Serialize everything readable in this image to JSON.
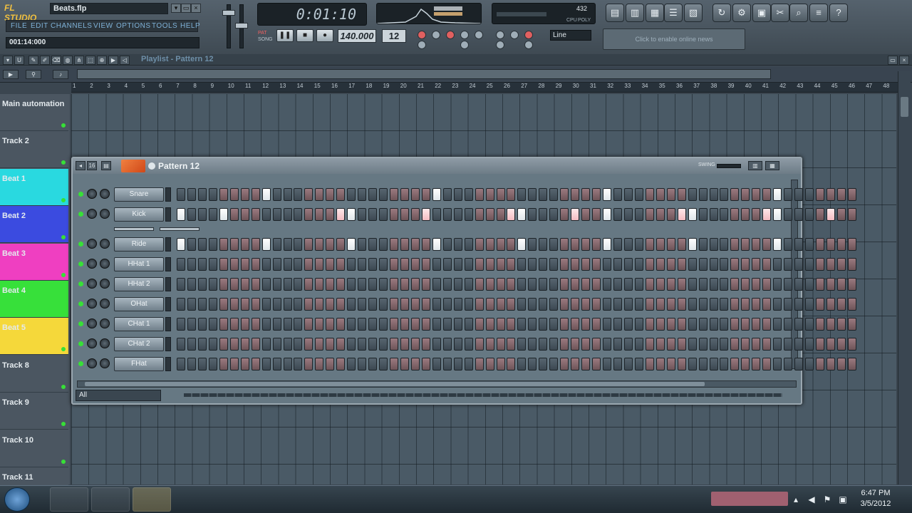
{
  "app": {
    "logo": "FL STUDIO",
    "filename": "Beats.flp"
  },
  "menu": [
    "FILE",
    "EDIT",
    "CHANNELS",
    "VIEW",
    "OPTIONS",
    "TOOLS",
    "HELP"
  ],
  "hint": "001:14:000",
  "transport": {
    "time": "0:01:10",
    "tempo": "140.000",
    "pattern_num": "12",
    "snap": "Line",
    "news": "Click to enable online news",
    "mode_label_pat": "PAT",
    "mode_label_song": "SONG"
  },
  "cpu": {
    "ram": "432",
    "label_cpu": "CPU",
    "label_poly": "POLY"
  },
  "playlist": {
    "title": "Playlist - Pattern 12",
    "ruler": [
      "1",
      "2",
      "3",
      "4",
      "5",
      "6",
      "7",
      "8",
      "9",
      "10",
      "11",
      "12",
      "13",
      "14",
      "15",
      "16",
      "17",
      "18",
      "19",
      "20",
      "21",
      "22",
      "23",
      "24",
      "25",
      "26",
      "27",
      "28",
      "29",
      "30",
      "31",
      "32",
      "33",
      "34",
      "35",
      "36",
      "37",
      "38",
      "39",
      "40",
      "41",
      "42",
      "43",
      "44",
      "45",
      "46",
      "47",
      "48"
    ],
    "tracks": [
      {
        "name": "Main automation",
        "color": "#4b5661"
      },
      {
        "name": "Track 2",
        "color": "#4b5661"
      },
      {
        "name": "Beat 1",
        "color": "#29d9e0"
      },
      {
        "name": "Beat 2",
        "color": "#3b4be0"
      },
      {
        "name": "Beat 3",
        "color": "#ef3fc1"
      },
      {
        "name": "Beat 4",
        "color": "#37e03a"
      },
      {
        "name": "Beat 5",
        "color": "#f5d83a"
      },
      {
        "name": "Track 8",
        "color": "#4b5661"
      },
      {
        "name": "Track 9",
        "color": "#4b5661"
      },
      {
        "name": "Track 10",
        "color": "#4b5661"
      },
      {
        "name": "Track 11",
        "color": "#4b5661"
      }
    ]
  },
  "sequencer": {
    "title": "Pattern 12",
    "swing_label": "SWING",
    "filter": "All",
    "channels": [
      {
        "name": "Snare",
        "on": [
          8,
          24,
          40,
          56
        ],
        "pink": []
      },
      {
        "name": "Kick",
        "on": [
          0,
          4,
          16,
          32,
          40,
          48,
          56,
          64
        ],
        "pink": [
          15,
          23,
          31,
          37,
          47,
          55,
          61
        ]
      },
      {
        "name": "Ride",
        "on": [
          0,
          8,
          16,
          24,
          32,
          40,
          48,
          56
        ],
        "pink": []
      },
      {
        "name": "HHat 1",
        "on": [],
        "pink": []
      },
      {
        "name": "HHat 2",
        "on": [],
        "pink": []
      },
      {
        "name": "OHat",
        "on": [],
        "pink": []
      },
      {
        "name": "CHat 1",
        "on": [],
        "pink": []
      },
      {
        "name": "CHat 2",
        "on": [],
        "pink": []
      },
      {
        "name": "FHat",
        "on": [],
        "pink": []
      }
    ]
  },
  "taskbar": {
    "time": "6:47 PM",
    "date": "3/5/2012"
  }
}
